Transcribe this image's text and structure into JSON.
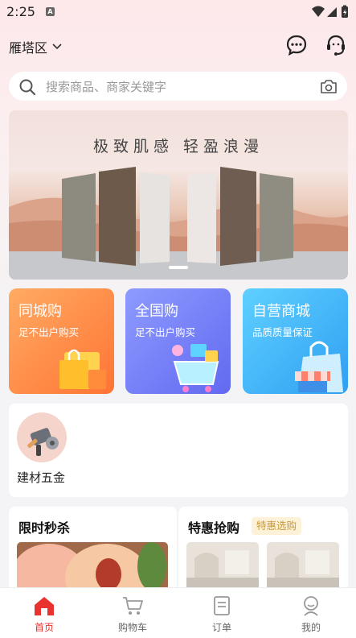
{
  "status_bar": {
    "time": "2:25",
    "sim_badge": "A"
  },
  "header": {
    "location": "雁塔区"
  },
  "search": {
    "placeholder": "搜索商品、商家关键字"
  },
  "banner": {
    "headline": "极致肌感 轻盈浪漫"
  },
  "service_cards": [
    {
      "title": "同城购",
      "subtitle": "足不出户购买",
      "color": "#ff7f3c"
    },
    {
      "title": "全国购",
      "subtitle": "足不出户购买",
      "color": "#6f7ff7"
    },
    {
      "title": "自营商城",
      "subtitle": "品质质量保证",
      "color": "#3eb5f6"
    }
  ],
  "category": {
    "label": "建材五金"
  },
  "promotions": {
    "flash_sale": {
      "title": "限时秒杀"
    },
    "special_deal": {
      "title": "特惠抢购",
      "tag": "特惠选购"
    }
  },
  "tabbar": {
    "items": [
      {
        "label": "首页",
        "active": true
      },
      {
        "label": "购物车",
        "active": false
      },
      {
        "label": "订单",
        "active": false
      },
      {
        "label": "我的",
        "active": false
      }
    ],
    "active_color": "#e8332f"
  }
}
